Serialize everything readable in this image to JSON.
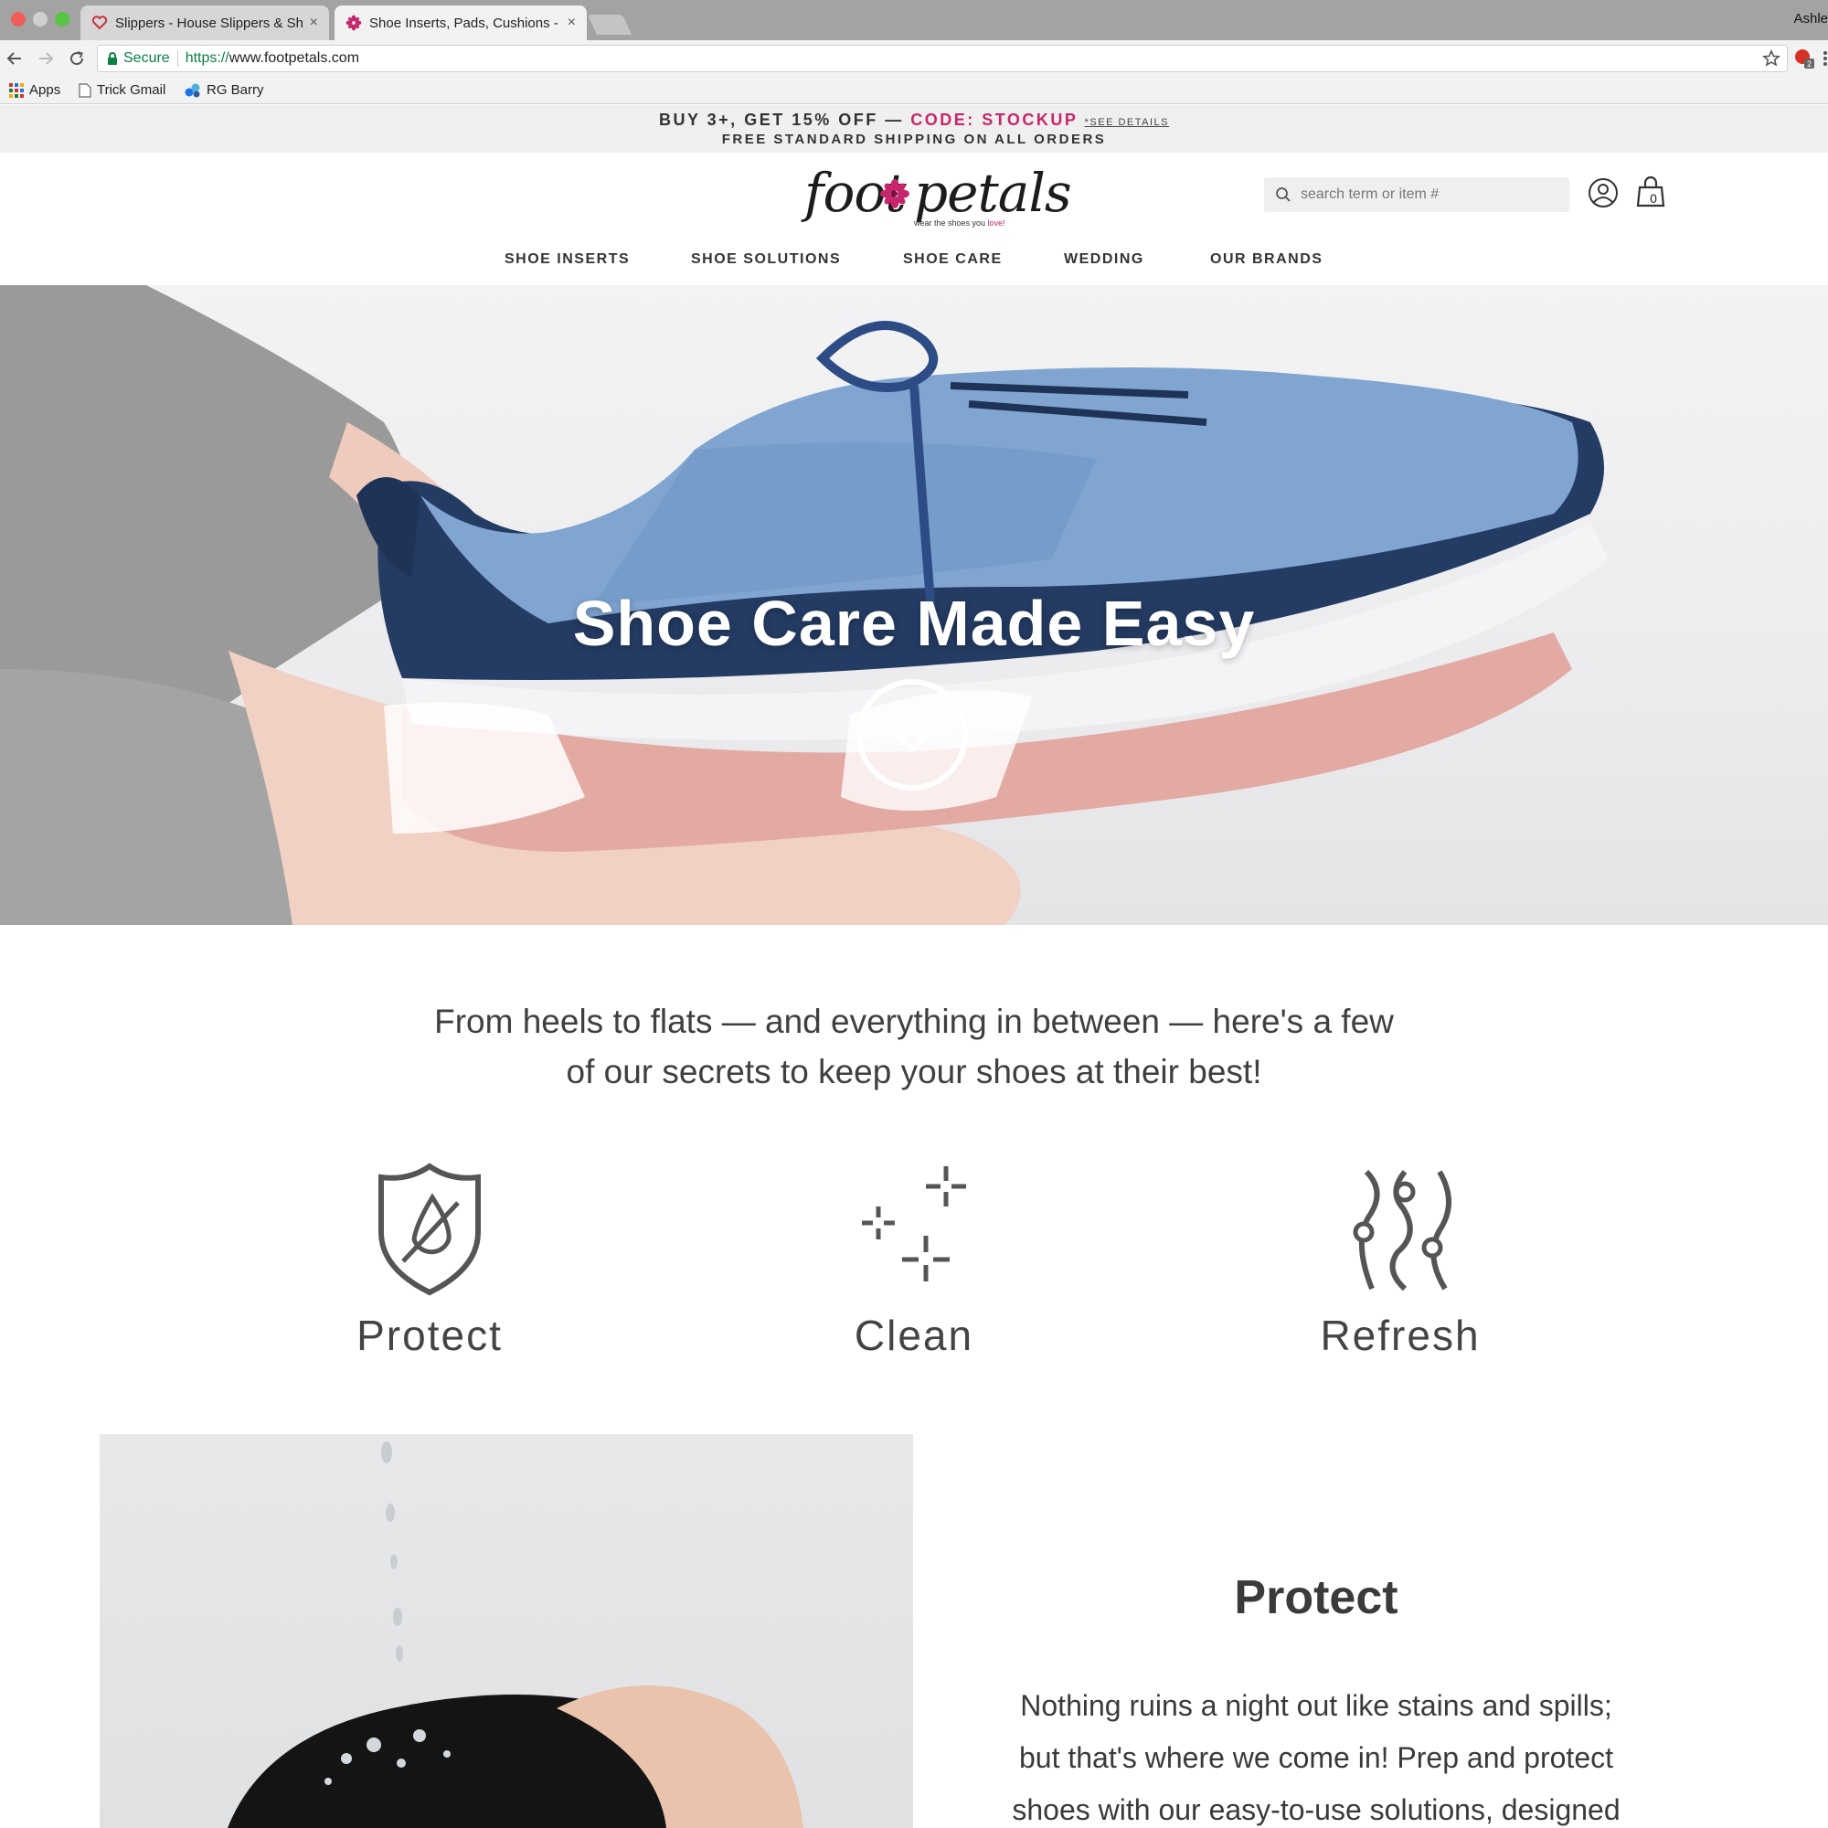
{
  "browser": {
    "tabs": [
      {
        "title": "Slippers - House Slippers & Sh",
        "close": "×"
      },
      {
        "title": "Shoe Inserts, Pads, Cushions -",
        "close": "×"
      }
    ],
    "profile": "Ashle",
    "security_label": "Secure",
    "url_scheme": "https://",
    "url_host": "www.footpetals.com",
    "bookmarks": [
      "Apps",
      "Trick Gmail",
      "RG Barry"
    ],
    "extension_badge": "2"
  },
  "promo": {
    "offer": "BUY 3+, GET 15% OFF —",
    "code": "CODE: STOCKUP",
    "details": "*SEE DETAILS",
    "shipping": "FREE STANDARD SHIPPING ON ALL ORDERS"
  },
  "header": {
    "logo": {
      "foot": "foot",
      "petals": "petals",
      "tagline": "wear the shoes you",
      "tagline_love": "love!"
    },
    "search_placeholder": "search term or item #",
    "cart_count": "0"
  },
  "nav": [
    "SHOE INSERTS",
    "SHOE SOLUTIONS",
    "SHOE CARE",
    "WEDDING",
    "OUR BRANDS"
  ],
  "hero": {
    "title": "Shoe Care Made Easy"
  },
  "intro": {
    "line1": "From heels to flats — and everything in between — here's a few",
    "line2": "of our secrets to keep your shoes at their best!"
  },
  "pillars": [
    {
      "label": "Protect",
      "icon": "shield-drop-icon"
    },
    {
      "label": "Clean",
      "icon": "sparkle-icon"
    },
    {
      "label": "Refresh",
      "icon": "wavy-lines-icon"
    }
  ],
  "feature": {
    "title": "Protect",
    "lines": [
      "Nothing ruins a night out like stains and spills;",
      "but that's where we come in! Prep and protect",
      "shoes with our easy-to-use solutions, designed"
    ]
  },
  "colors": {
    "brand_pink": "#c6266b",
    "text_dark": "#3a3a3a",
    "promo_bg": "#efefef"
  }
}
